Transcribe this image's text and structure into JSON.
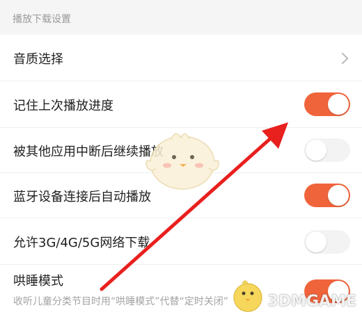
{
  "section_header": "播放下载设置",
  "settings": [
    {
      "label": "音质选择",
      "control": "chevron"
    },
    {
      "label": "记住上次播放进度",
      "control": "toggle",
      "on": true
    },
    {
      "label": "被其他应用中断后继续播放",
      "control": "toggle",
      "on": false
    },
    {
      "label": "蓝牙设备连接后自动播放",
      "control": "toggle",
      "on": true
    },
    {
      "label": "允许3G/4G/5G网络下载",
      "control": "toggle",
      "on": false
    },
    {
      "label": "哄睡模式",
      "sublabel": "收听儿童分类节目时用“哄睡模式”代替“定时关闭”",
      "control": "toggle",
      "on": true
    }
  ],
  "watermark": "3DMGAME",
  "colors": {
    "accent": "#f0643c",
    "arrow": "#e8201e",
    "toggle_off": "#f3f3f3",
    "header_bg": "#f5f5f5"
  },
  "icons": [
    "chevron-right-icon",
    "mascot-chick-icon",
    "mascot-bird-icon"
  ]
}
